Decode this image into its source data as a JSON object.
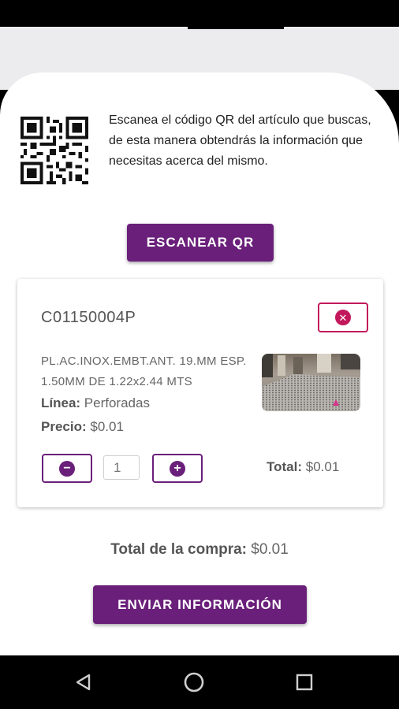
{
  "scanner": {
    "instructions": "Escanea el código QR del artículo que buscas, de esta manera obtendrás la información que necesitas acerca del mismo.",
    "scan_button_label": "ESCANEAR QR"
  },
  "cart_item": {
    "code": "C01150004P",
    "description": "PL.AC.INOX.EMBT.ANT. 19.MM ESP. 1.50MM DE 1.22x2.44 MTS",
    "linea_label": "Línea:",
    "linea_value": "Perforadas",
    "precio_label": "Precio:",
    "precio_value": "$0.01",
    "quantity": "1",
    "total_label": "Total:",
    "total_value": "$0.01"
  },
  "summary": {
    "purchase_total_label": "Total de la compra:",
    "purchase_total_value": "$0.01",
    "send_button_label": "ENVIAR INFORMACIÓN"
  },
  "icons": {
    "qr": "qr-code-icon",
    "remove": "close-circle-icon",
    "decrement": "minus-circle-icon",
    "increment": "plus-circle-icon",
    "nav_back": "back-triangle-icon",
    "nav_home": "home-circle-icon",
    "nav_recent": "recent-apps-icon"
  },
  "colors": {
    "primary": "#6a1f7a",
    "remove_accent": "#c2185b",
    "background": "#ececee"
  }
}
